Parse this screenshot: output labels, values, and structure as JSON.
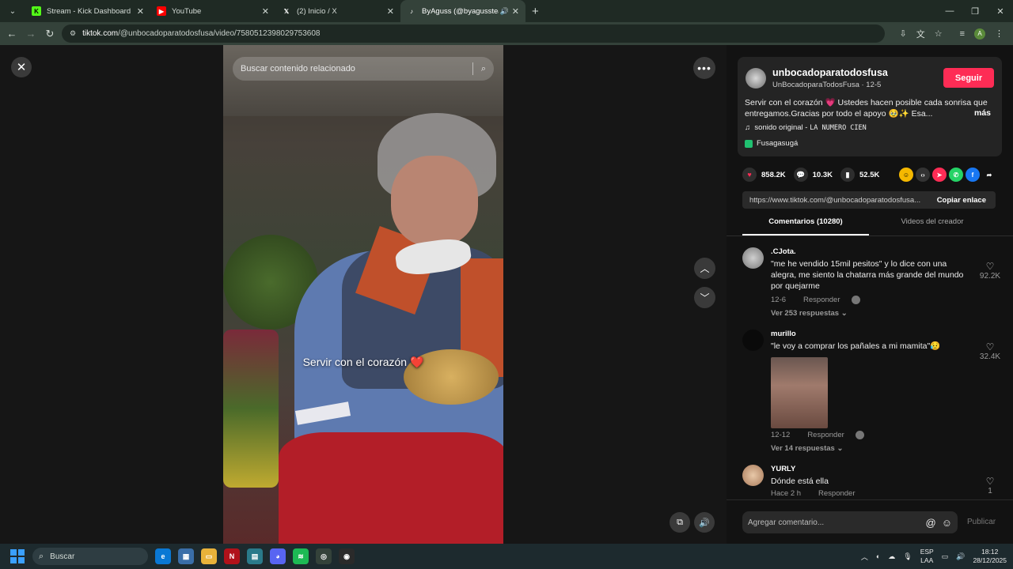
{
  "browser": {
    "tabs": [
      {
        "title": "Stream - Kick Dashboard",
        "icon": "kick-icon",
        "color": "#53fc18"
      },
      {
        "title": "YouTube",
        "icon": "youtube-icon",
        "color": "#ff0000"
      },
      {
        "title": "(2) Inicio / X",
        "icon": "x-icon",
        "color": "#000000"
      },
      {
        "title": "ByAguss (@byagussteam) |",
        "icon": "tiktok-icon",
        "color": "#000000"
      }
    ],
    "url_host": "tiktok.com",
    "url_path": "/@unbocadoparatodosfusa/video/7580512398029753608"
  },
  "video": {
    "search_placeholder": "Buscar contenido relacionado",
    "caption": "Servir con el corazón",
    "caption_emoji": "❤️"
  },
  "post": {
    "username": "unbocadoparatodosfusa",
    "display_line": "UnBocadoparaTodosFusa · 12-5",
    "follow_label": "Seguir",
    "description": "Servir con el corazón 💗 Ustedes hacen posible cada sonrisa que entregamos.Gracias por todo el apoyo 🥹✨ Esa...",
    "more_label": "más",
    "music": "sonido original - ",
    "music_artist": "LA NUMERO CIEN",
    "location": "Fusagasugá",
    "likes": "858.2K",
    "comments": "10.3K",
    "saves": "52.5K",
    "link": "https://www.tiktok.com/@unbocadoparatodosfusa...",
    "copy_label": "Copiar enlace",
    "tab_comments": "Comentarios (10280)",
    "tab_videos": "Videos del creador"
  },
  "comments": [
    {
      "name": ".CJota.",
      "text": "\"me he vendido 15mil pesitos\" y lo dice con una alegra, me siento la chatarra más grande del mundo por quejarme",
      "date": "12-6",
      "reply": "Responder",
      "replies": "Ver 253 respuestas",
      "likes": "92.2K"
    },
    {
      "name": "murillo",
      "text": "\"le voy a comprar los pañales a mi mamita\"😥",
      "date": "12-12",
      "reply": "Responder",
      "replies": "Ver 14 respuestas",
      "likes": "32.4K"
    },
    {
      "name": "YURLY",
      "text": "Dónde está ella",
      "date": "Hace 2 h",
      "reply": "Responder",
      "likes": "1"
    }
  ],
  "compose": {
    "placeholder": "Agregar comentario...",
    "publish": "Publicar"
  },
  "taskbar": {
    "search": "Buscar",
    "lang1": "ESP",
    "lang2": "LAA",
    "time": "18:12",
    "date": "28/12/2025"
  }
}
